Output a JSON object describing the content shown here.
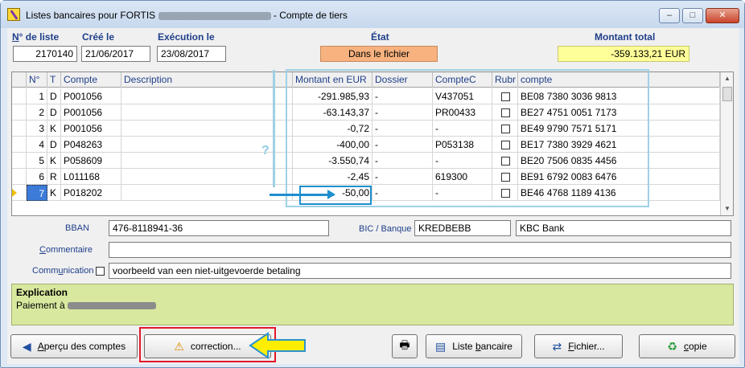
{
  "window": {
    "title_prefix": "Listes bancaires pour FORTIS",
    "title_suffix": "- Compte de tiers",
    "btn_minimize": "–",
    "btn_maximize": "□",
    "btn_close": "✕"
  },
  "header": {
    "num_label": "N° de liste",
    "num_value": "2170140",
    "created_label": "Créé le",
    "created_value": "21/06/2017",
    "exec_label": "Exécution le",
    "exec_value": "23/08/2017",
    "state_label": "État",
    "state_value": "Dans le fichier",
    "total_label": "Montant total",
    "total_value": "-359.133,21  EUR"
  },
  "grid": {
    "columns": [
      "N°",
      "T",
      "Compte",
      "Description",
      "Montant en EUR",
      "Dossier",
      "CompteC",
      "Rubr",
      "compte"
    ],
    "rows": [
      {
        "n": "1",
        "t": "D",
        "compte": "P001056",
        "desc": "",
        "montant": "-291.985,93",
        "dossier": "-",
        "comptec": "V437051",
        "iban": "BE08 7380 3036 9813"
      },
      {
        "n": "2",
        "t": "D",
        "compte": "P001056",
        "desc": "",
        "montant": "-63.143,37",
        "dossier": "-",
        "comptec": "PR00433",
        "iban": "BE27 4751 0051 7173"
      },
      {
        "n": "3",
        "t": "K",
        "compte": "P001056",
        "desc": "",
        "montant": "-0,72",
        "dossier": "-",
        "comptec": "-",
        "iban": "BE49 9790 7571 5171"
      },
      {
        "n": "4",
        "t": "D",
        "compte": "P048263",
        "desc": "",
        "montant": "-400,00",
        "dossier": "-",
        "comptec": "P053138",
        "iban": "BE17 7380 3929 4621"
      },
      {
        "n": "5",
        "t": "K",
        "compte": "P058609",
        "desc": "",
        "montant": "-3.550,74",
        "dossier": "-",
        "comptec": "-",
        "iban": "BE20 7506 0835 4456"
      },
      {
        "n": "6",
        "t": "R",
        "compte": "L011168",
        "desc": "",
        "montant": "-2,45",
        "dossier": "-",
        "comptec": "619300",
        "iban": "BE91 6792 0083 6476"
      },
      {
        "n": "7",
        "t": "K",
        "compte": "P018202",
        "desc": "",
        "montant": "-50,00",
        "dossier": "-",
        "comptec": "-",
        "iban": "BE46 4768 1189 4136"
      }
    ]
  },
  "annotation": {
    "qmark": "?"
  },
  "details": {
    "bban_label": "BBAN",
    "bban_value": "476-8118941-36",
    "bic_label": "BIC / Banque",
    "bic_value": "KREDBEBB",
    "bank_name": "KBC Bank",
    "comment_label": "Commentaire",
    "comment_value": "",
    "communication_label": "Communication",
    "communication_value": "voorbeeld van een niet-uitgevoerde betaling"
  },
  "explication": {
    "title": "Explication",
    "text": "Paiement à"
  },
  "buttons": {
    "apercu_a": "A",
    "apercu_rest": "perçu des comptes",
    "correction": "correction...",
    "liste_pre": "Liste ",
    "liste_u": "b",
    "liste_post": "ancaire",
    "fichier_u": "F",
    "fichier_rest": "ichier...",
    "copie_u": "c",
    "copie_rest": "opie"
  }
}
